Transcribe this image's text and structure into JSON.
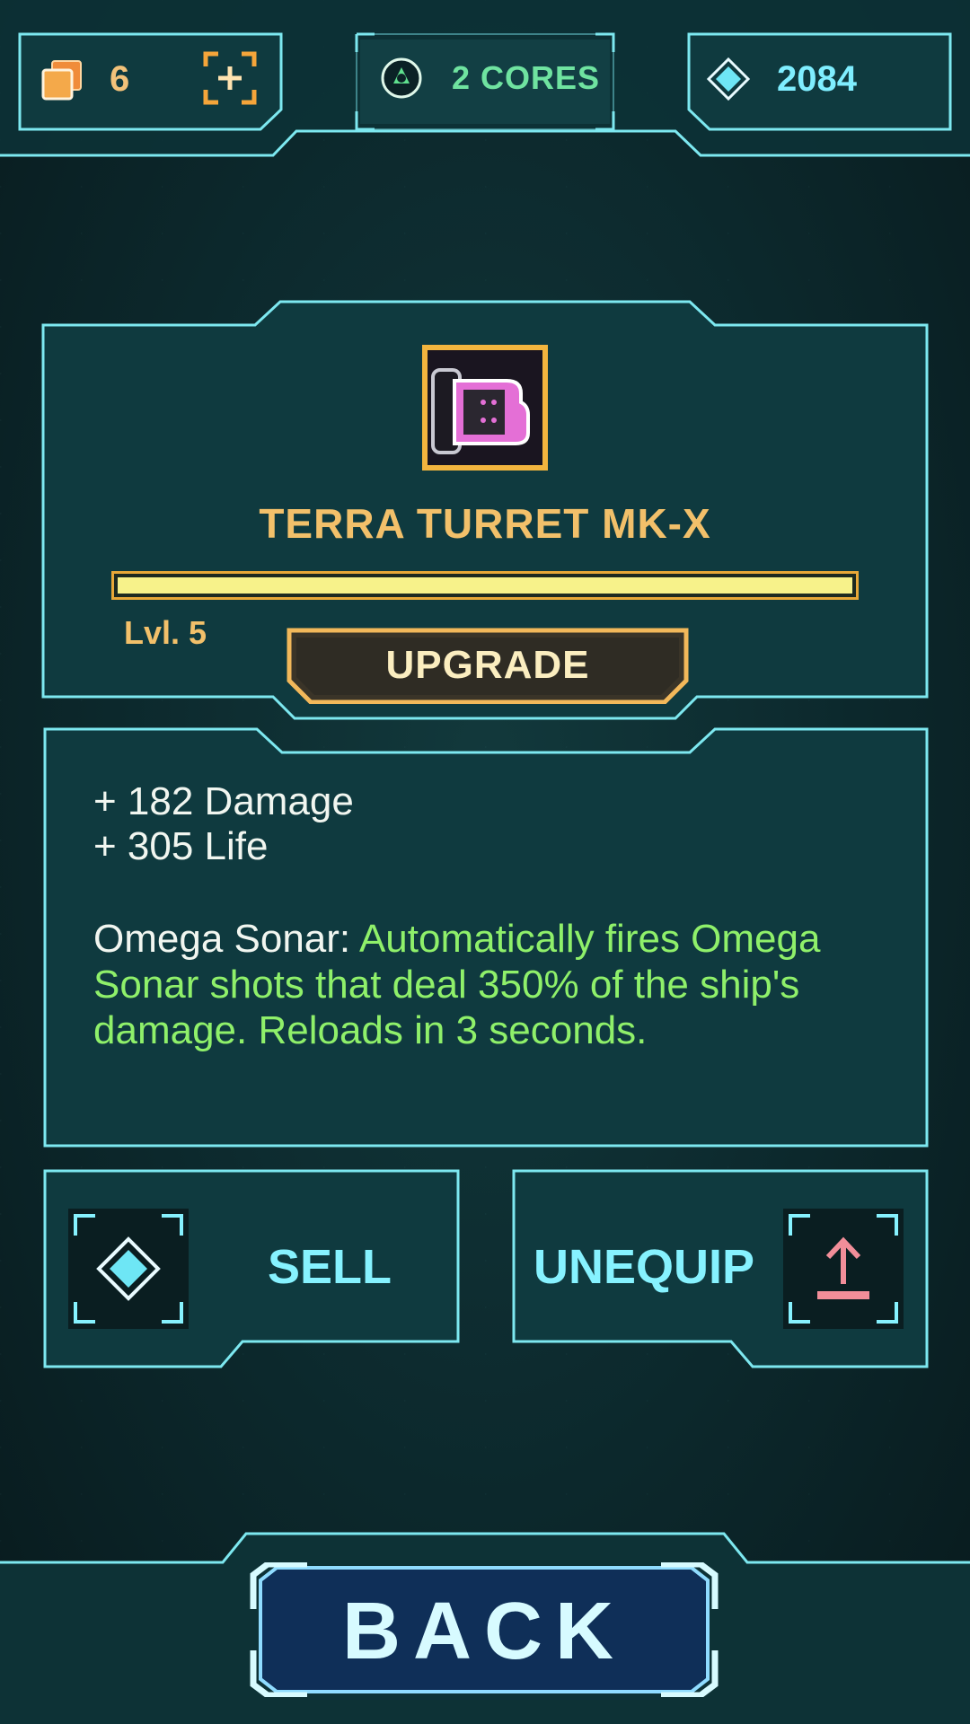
{
  "topbar": {
    "cards_count": "6",
    "cores_label": "2 CORES",
    "gems_count": "2084"
  },
  "item": {
    "name": "TERRA TURRET MK-X",
    "level_label": "Lvl. 5",
    "xp_progress": 1.0,
    "upgrade_label": "UPGRADE"
  },
  "stats": {
    "lines": [
      "+ 182 Damage",
      "+ 305 Life"
    ],
    "ability_name": "Omega Sonar: ",
    "ability_desc": "Automatically fires Omega Sonar shots that deal 350% of the ship's damage. Reloads in 3 seconds."
  },
  "actions": {
    "sell_label": "SELL",
    "unequip_label": "UNEQUIP"
  },
  "back_label": "BACK",
  "colors": {
    "frame": "#7de8f0",
    "gold": "#f2c06a",
    "ability_green": "#8ff06a",
    "cyan_text": "#86f2ff",
    "unequip_arrow": "#f28e99"
  },
  "icons": {
    "cards": "stacked-cards-icon",
    "add": "add-bracket-icon",
    "cores": "core-orb-icon",
    "gem": "diamond-gem-icon",
    "item": "turret-icon",
    "sell": "diamond-gem-icon",
    "unequip": "upload-arrow-icon"
  }
}
